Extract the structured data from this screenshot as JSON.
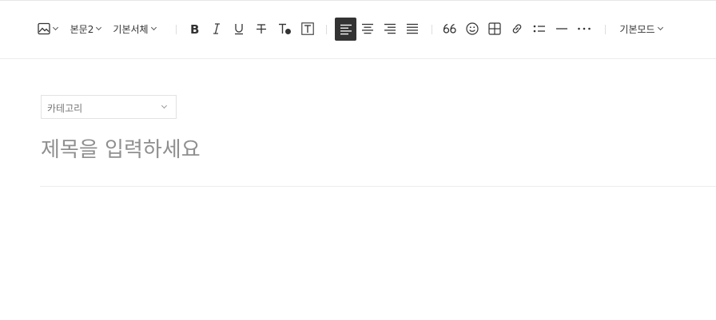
{
  "toolbar": {
    "paragraph_style": "본문2",
    "font_family": "기본서체",
    "mode": "기본모드",
    "icons": [
      "image-icon",
      "bold-icon",
      "italic-icon",
      "underline-icon",
      "strikethrough-icon",
      "text-color-icon",
      "text-background-icon",
      "align-left-icon",
      "align-center-icon",
      "align-right-icon",
      "align-justify-icon",
      "quote-icon",
      "emoji-icon",
      "table-icon",
      "link-icon",
      "bullet-list-icon",
      "horizontal-rule-icon",
      "more-icon"
    ],
    "active_alignment": "left",
    "active_color": "#333333"
  },
  "editor": {
    "category_placeholder": "카테고리",
    "title_placeholder": "제목을 입력하세요"
  }
}
